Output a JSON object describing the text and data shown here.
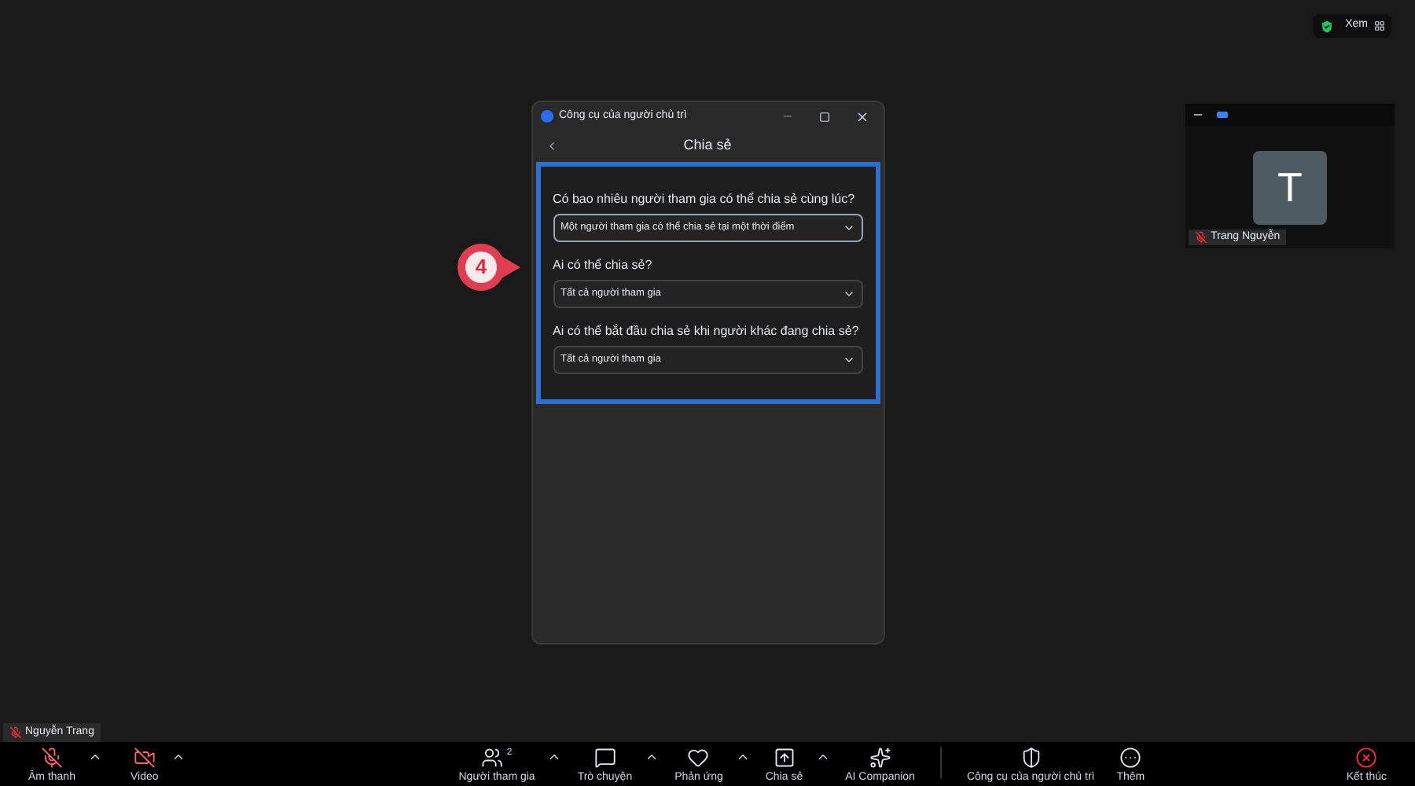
{
  "top_bar": {
    "view_label": "Xem"
  },
  "participant_tile": {
    "initial": "T",
    "name": "Trang Nguyễn",
    "muted": true
  },
  "self_view": {
    "name": "Nguyễn Trang",
    "muted": true
  },
  "step_marker": {
    "number": "4"
  },
  "dialog": {
    "title": "Công cụ của người chủ trì",
    "header": "Chia sẻ",
    "highlighted": true,
    "fields": [
      {
        "label": "Có bao nhiêu người tham gia có thể chia sẻ cùng lúc?",
        "value": "Một người tham gia có thể chia sẻ tại một thời điểm",
        "focused": true
      },
      {
        "label": "Ai có thể chia sẻ?",
        "value": "Tất cả người tham gia",
        "focused": false
      },
      {
        "label": "Ai có thể bắt đầu chia sẻ khi người khác đang chia sẻ?",
        "value": "Tất cả người tham gia",
        "focused": false
      }
    ]
  },
  "toolbar": [
    {
      "label": "Âm thanh",
      "kind": "off",
      "menu": true
    },
    {
      "label": "Video",
      "kind": "off",
      "menu": true
    },
    {
      "label": "Người tham gia",
      "kind": "normal",
      "menu": true,
      "count": "2"
    },
    {
      "label": "Trò chuyện",
      "kind": "normal",
      "menu": true
    },
    {
      "label": "Phản ứng",
      "kind": "normal",
      "menu": true
    },
    {
      "label": "Chia sẻ",
      "kind": "normal",
      "menu": true
    },
    {
      "label": "AI Companion",
      "kind": "normal",
      "menu": false
    },
    {
      "label": "Công cụ của người chủ trì",
      "kind": "normal",
      "menu": false
    },
    {
      "label": "Thêm",
      "kind": "normal",
      "menu": false
    },
    {
      "label": "Kết thúc",
      "kind": "end",
      "menu": false
    }
  ]
}
